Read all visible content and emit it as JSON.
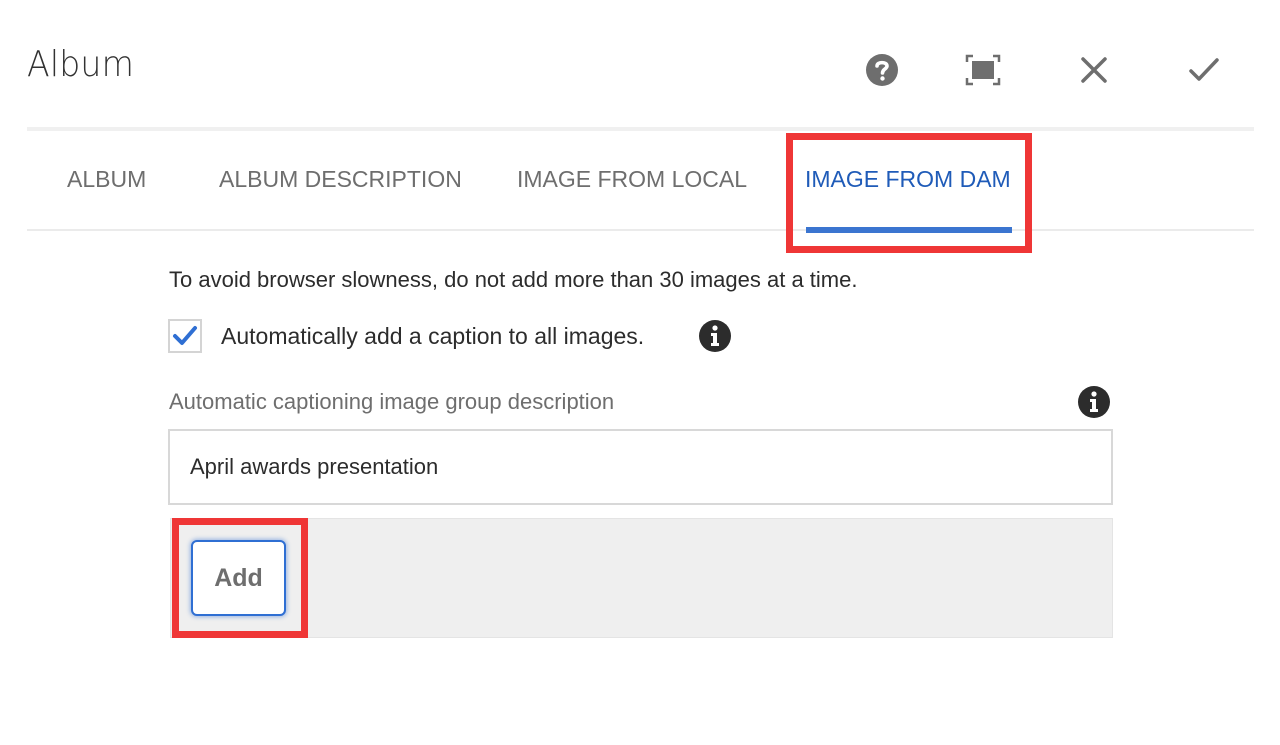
{
  "dialog": {
    "title": "Album",
    "header_actions": [
      {
        "name": "help",
        "icon": "help-icon"
      },
      {
        "name": "fullscreen",
        "icon": "fullscreen-icon"
      },
      {
        "name": "close",
        "icon": "close-icon"
      },
      {
        "name": "done",
        "icon": "checkmark-icon"
      }
    ]
  },
  "tabs": [
    {
      "label": "ALBUM",
      "active": false
    },
    {
      "label": "ALBUM DESCRIPTION",
      "active": false
    },
    {
      "label": "IMAGE FROM LOCAL",
      "active": false
    },
    {
      "label": "IMAGE FROM DAM",
      "active": true
    }
  ],
  "content": {
    "note": "To avoid browser slowness, do not add more than 30 images at a time.",
    "auto_caption": {
      "label": "Automatically add a caption to all images.",
      "checked": true,
      "icon": "info-icon"
    },
    "group_description": {
      "label": "Automatic captioning image group description",
      "value": "April awards presentation",
      "icon": "info-icon"
    },
    "add_button": {
      "label": "Add"
    }
  },
  "highlights": [
    {
      "target": "tab-image-from-dam",
      "color": "#ef3636"
    },
    {
      "target": "add-button",
      "color": "#ef3636"
    }
  ],
  "colors": {
    "active_tab": "#1f5bb8",
    "tab_underline": "#3b75d0",
    "highlight": "#ef3636",
    "checkbox_check": "#2f6fd3"
  }
}
